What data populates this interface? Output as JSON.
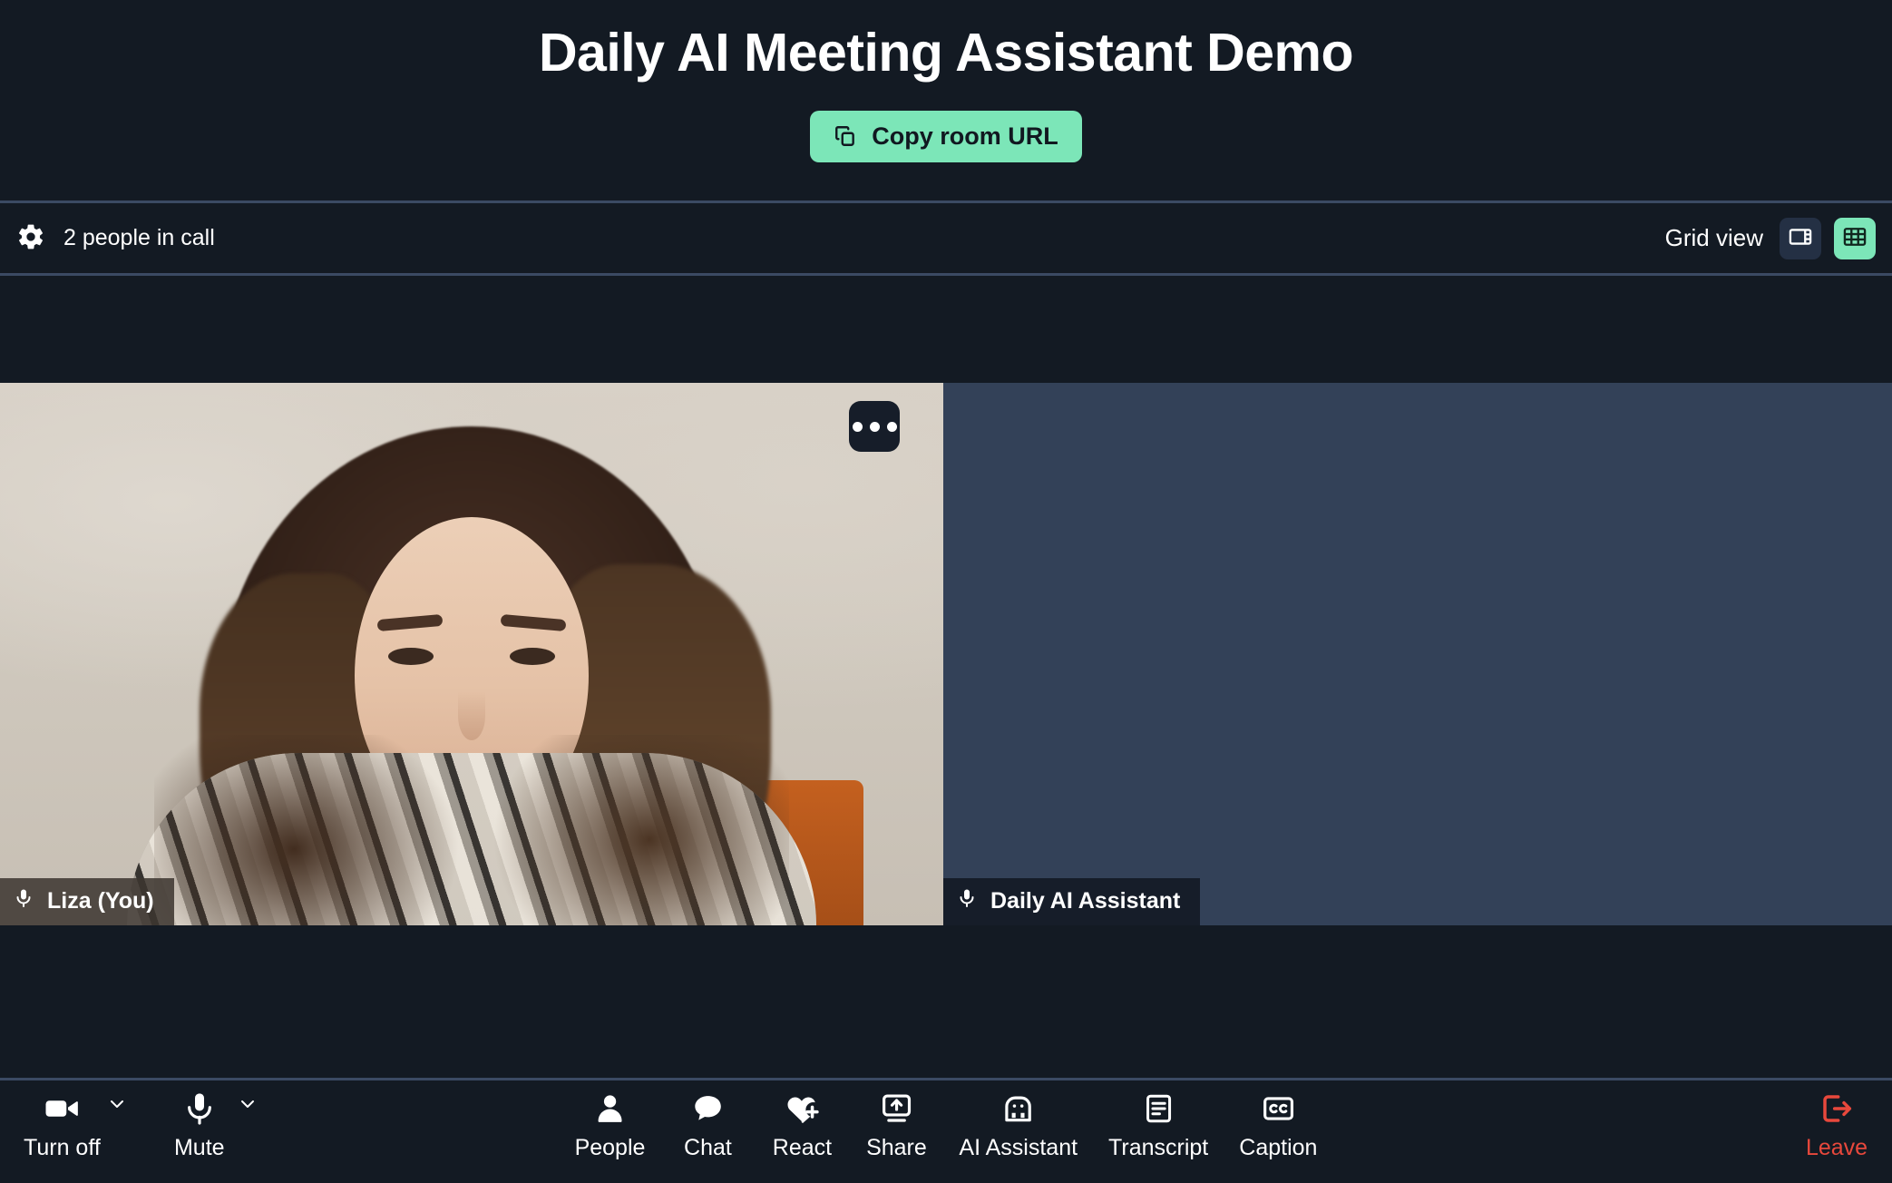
{
  "header": {
    "title": "Daily AI Meeting Assistant Demo",
    "copy_button": {
      "label": "Copy room URL",
      "icon": "copy-icon",
      "bg_color": "#7ce6b8"
    }
  },
  "subbar": {
    "settings_icon": "gear-icon",
    "people_count_text": "2 people in call",
    "view_label": "Grid view",
    "speaker_view_icon": "speaker-view-icon",
    "grid_view_icon": "grid-view-icon",
    "active_view": "grid",
    "active_color": "#7ce6b8"
  },
  "stage": {
    "tiles": [
      {
        "name": "Liza (You)",
        "mic_icon": "microphone-icon",
        "has_video": true,
        "more_icon": "more-options-icon"
      },
      {
        "name": "Daily AI Assistant",
        "mic_icon": "microphone-icon",
        "has_video": false,
        "background_color": "#334158"
      }
    ]
  },
  "toolbar": {
    "left": [
      {
        "label": "Turn off",
        "icon": "camera-icon",
        "has_chevron": true
      },
      {
        "label": "Mute",
        "icon": "microphone-icon",
        "has_chevron": true
      }
    ],
    "center": [
      {
        "label": "People",
        "icon": "people-icon"
      },
      {
        "label": "Chat",
        "icon": "chat-bubble-icon"
      },
      {
        "label": "React",
        "icon": "heart-plus-icon"
      },
      {
        "label": "Share",
        "icon": "share-screen-icon"
      },
      {
        "label": "AI Assistant",
        "icon": "robot-icon"
      },
      {
        "label": "Transcript",
        "icon": "transcript-icon"
      },
      {
        "label": "Caption",
        "icon": "closed-caption-icon"
      }
    ],
    "right": [
      {
        "label": "Leave",
        "icon": "leave-icon",
        "color": "#e8483c"
      }
    ]
  },
  "colors": {
    "background": "#131a23",
    "divider": "#3b4a63",
    "accent": "#7ce6b8",
    "danger": "#e8483c",
    "bot_tile": "#334158"
  }
}
